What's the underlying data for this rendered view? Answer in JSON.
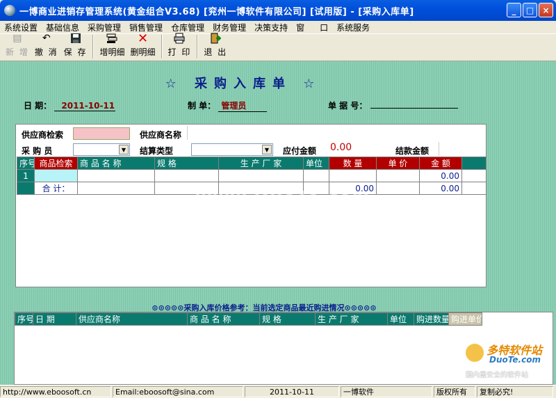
{
  "window": {
    "title": "一博商业进销存管理系统(黄金组合V3.68)     [兖州一博软件有限公司]   [试用版] - [采购入库单]",
    "minimize": "_",
    "maximize": "□",
    "close": "×"
  },
  "menu": [
    "系统设置",
    "基础信息",
    "采购管理",
    "销售管理",
    "仓库管理",
    "财务管理",
    "决策支持",
    "窗",
    "口",
    "系统服务"
  ],
  "toolbar": {
    "new": "新 增",
    "cancel": "撤 消",
    "save": "保 存",
    "add_detail": "增明细",
    "delete_detail": "删明细",
    "print": "打 印",
    "exit": "退 出"
  },
  "form": {
    "heading": "☆  采购入库单  ☆",
    "date_label": "日    期：",
    "date_value": "2011-10-11",
    "maker_label": "制    单：",
    "maker_value": "管理员",
    "doc_no_label": "单 据 号：",
    "doc_no_value": "",
    "supplier_search_label": "供应商检索",
    "supplier_name_label": "供应商名称",
    "buyer_label": "采  购  员",
    "settle_type_label": "结算类型",
    "payable_label": "应付金额",
    "payable_value": "0.00",
    "settle_amount_label": "结款金额"
  },
  "detail_table": {
    "headers": [
      "序号",
      "商品检索",
      "商 品 名 称",
      "规 格",
      "生 产 厂 家",
      "单位",
      "数 量",
      "单 价",
      "金 额"
    ],
    "rows": [
      {
        "no": "1",
        "amount": "0.00"
      }
    ],
    "total_label": "合 计：",
    "total_qty": "0.00",
    "total_amount": "0.00"
  },
  "reference": {
    "caption": "⊙⊙⊙⊙⊙采购入库价格参考：当前选定商品最近购进情况⊙⊙⊙⊙⊙",
    "headers": [
      "序号",
      "日  期",
      "供应商名称",
      "商 品 名 称",
      "规 格",
      "生 产 厂 家",
      "单位",
      "购进数量",
      "购进单价"
    ]
  },
  "status": {
    "url": "http://www.eboosoft.cn",
    "email": "Email:eboosoft@sina.com",
    "date": "2011-10-11",
    "company": "一博软件",
    "rights": "版权所有",
    "copy": "复制必究!"
  },
  "watermark": "www.DuoTe.com",
  "site_logo": {
    "line1": "多特软件站",
    "line2": "DuoTe.com",
    "line3": "国内最安全的软件站"
  }
}
